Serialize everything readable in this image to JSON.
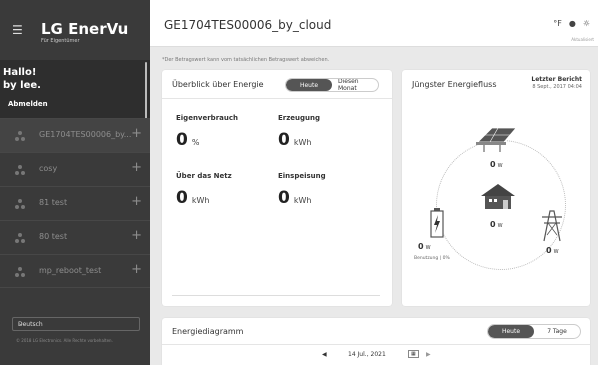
{
  "brand": {
    "name": "LG EnerVu",
    "subtitle": "Für Eigentümer"
  },
  "sidebar": {
    "greeting_line1": "Hallo!",
    "greeting_line2": "by lee.",
    "logout_label": "Abmelden",
    "systems": [
      {
        "label": "GE1704TES00006_by...",
        "action": "+"
      },
      {
        "label": "cosy",
        "action": "+"
      },
      {
        "label": "81 test",
        "action": "+"
      },
      {
        "label": "80 test",
        "action": "+"
      },
      {
        "label": "mp_reboot_test",
        "action": "+"
      }
    ],
    "language": "Deutsch",
    "copyright": "© 2018 LG Electronics. Alle Rechte vorbehalten."
  },
  "header": {
    "title": "GE1704TES00006_by_cloud",
    "unit_toggle": "°F",
    "weather_note": "Aktualisiert"
  },
  "disclaimer": "*Der Betragswert kann vom tatsächlichen Betragswert abweichen.",
  "overview": {
    "title": "Überblick über Energie",
    "tabs": [
      {
        "label": "Heute",
        "active": true
      },
      {
        "label": "Diesen Monat",
        "active": false
      }
    ],
    "metrics": {
      "consumption": {
        "label": "Eigenverbrauch",
        "value": "0",
        "unit": "%"
      },
      "generation": {
        "label": "Erzeugung",
        "value": "0",
        "unit": "kWh"
      },
      "grid": {
        "label": "Über das Netz",
        "value": "0",
        "unit": "kWh"
      },
      "feed_in": {
        "label": "Einspeisung",
        "value": "0",
        "unit": "kWh"
      }
    }
  },
  "flow": {
    "title": "Jüngster Energiefluss",
    "report_label": "Letzter Bericht",
    "report_date": "8 Sept., 2017 04:04",
    "solar": {
      "value": "0",
      "unit": "W"
    },
    "house": {
      "value": "0",
      "unit": "W"
    },
    "battery": {
      "value": "0",
      "unit": "W"
    },
    "grid": {
      "value": "0",
      "unit": "W"
    },
    "self_sufficiency": "Benutzung | 0%"
  },
  "diagram": {
    "title": "Energiediagramm",
    "tabs": [
      {
        "label": "Heute",
        "active": true
      },
      {
        "label": "7 Tage",
        "active": false
      }
    ],
    "date": "14 Jul., 2021"
  },
  "colors": {
    "sidebar": "#3a3a3a",
    "accent": "#555555",
    "battery_bolt": "#333333"
  }
}
